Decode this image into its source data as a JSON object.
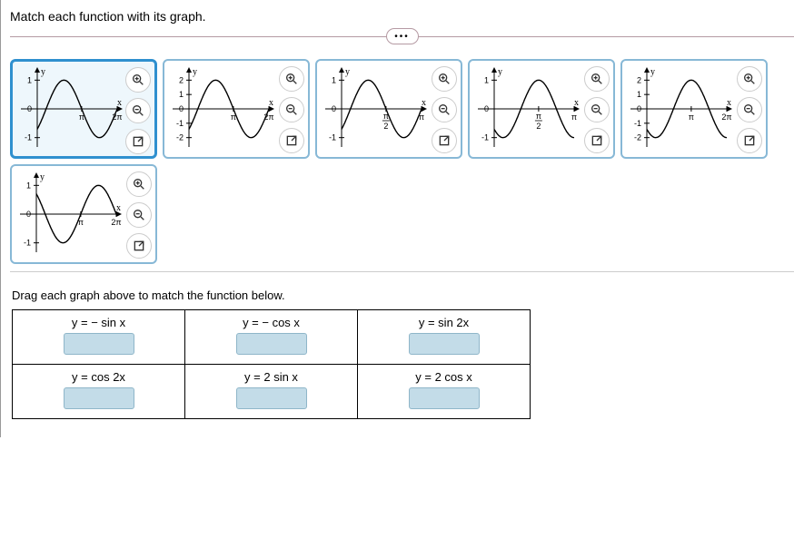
{
  "title": "Match each function with its graph.",
  "ellipsis": "•••",
  "instruction": "Drag each graph above to match the function below.",
  "icons": {
    "zoom_in": "zoom-in-icon",
    "zoom_out": "zoom-out-icon",
    "expand": "expand-icon"
  },
  "graphs": [
    {
      "id": 1,
      "selected": true,
      "y_ticks": [
        "1",
        "-1"
      ],
      "x_ticks": [
        "π",
        "2π"
      ],
      "amp": 1,
      "y_range": 1
    },
    {
      "id": 2,
      "selected": false,
      "y_ticks": [
        "2",
        "1",
        "-1",
        "-2"
      ],
      "x_ticks": [
        "π",
        "2π"
      ],
      "amp": 2,
      "y_range": 2
    },
    {
      "id": 3,
      "selected": false,
      "y_ticks": [
        "1",
        "-1"
      ],
      "x_ticks": [
        "π/2",
        "π"
      ],
      "amp": 1,
      "y_range": 1
    },
    {
      "id": 4,
      "selected": false,
      "y_ticks": [
        "1",
        "-1"
      ],
      "x_ticks": [
        "π/2",
        "π"
      ],
      "amp": 1,
      "y_range": 1
    },
    {
      "id": 5,
      "selected": false,
      "y_ticks": [
        "2",
        "1",
        "-1",
        "-2"
      ],
      "x_ticks": [
        "π",
        "2π"
      ],
      "amp": 2,
      "y_range": 2
    },
    {
      "id": 6,
      "selected": false,
      "y_ticks": [
        "1",
        "-1"
      ],
      "x_ticks": [
        "π",
        "2π"
      ],
      "amp": 1,
      "y_range": 1
    }
  ],
  "functions": {
    "row1": [
      "y = − sin x",
      "y = − cos x",
      "y = sin 2x"
    ],
    "row2": [
      "y = cos 2x",
      "y = 2 sin x",
      "y = 2 cos x"
    ]
  },
  "chart_data": [
    {
      "type": "line",
      "title": "",
      "xlabel": "x",
      "ylabel": "y",
      "xlim": [
        -0.785,
        6.283
      ],
      "ylim": [
        -1.2,
        1.2
      ],
      "x_ticks": [
        3.1416,
        6.2832
      ],
      "x_ticklabels": [
        "π",
        "2π"
      ],
      "y_ticks": [
        -1,
        0,
        1
      ],
      "function": "sin(x)",
      "amplitude": 1,
      "period": 6.2832,
      "phase": 0
    },
    {
      "type": "line",
      "title": "",
      "xlabel": "x",
      "ylabel": "y",
      "xlim": [
        -0.785,
        6.283
      ],
      "ylim": [
        -2.4,
        2.4
      ],
      "x_ticks": [
        3.1416,
        6.2832
      ],
      "x_ticklabels": [
        "π",
        "2π"
      ],
      "y_ticks": [
        -2,
        -1,
        0,
        1,
        2
      ],
      "function": "2*sin(x)",
      "amplitude": 2,
      "period": 6.2832,
      "phase": 0
    },
    {
      "type": "line",
      "title": "",
      "xlabel": "x",
      "ylabel": "y",
      "xlim": [
        -0.392,
        3.1416
      ],
      "ylim": [
        -1.2,
        1.2
      ],
      "x_ticks": [
        1.5708,
        3.1416
      ],
      "x_ticklabels": [
        "π/2",
        "π"
      ],
      "y_ticks": [
        -1,
        0,
        1
      ],
      "function": "sin(2x)",
      "amplitude": 1,
      "period": 3.1416,
      "phase": 0
    },
    {
      "type": "line",
      "title": "",
      "xlabel": "x",
      "ylabel": "y",
      "xlim": [
        -0.392,
        3.1416
      ],
      "ylim": [
        -1.2,
        1.2
      ],
      "x_ticks": [
        1.5708,
        3.1416
      ],
      "x_ticklabels": [
        "π/2",
        "π"
      ],
      "y_ticks": [
        -1,
        0,
        1
      ],
      "function": "-cos(2x)",
      "amplitude": 1,
      "period": 3.1416,
      "phase": 1.5708
    },
    {
      "type": "line",
      "title": "",
      "xlabel": "x",
      "ylabel": "y",
      "xlim": [
        -0.785,
        6.283
      ],
      "ylim": [
        -2.4,
        2.4
      ],
      "x_ticks": [
        3.1416,
        6.2832
      ],
      "x_ticklabels": [
        "π",
        "2π"
      ],
      "y_ticks": [
        -2,
        -1,
        0,
        1,
        2
      ],
      "function": "-2*cos(x)",
      "amplitude": 2,
      "period": 6.2832,
      "phase": 3.1416
    },
    {
      "type": "line",
      "title": "",
      "xlabel": "x",
      "ylabel": "y",
      "xlim": [
        -0.785,
        6.283
      ],
      "ylim": [
        -1.2,
        1.2
      ],
      "x_ticks": [
        3.1416,
        6.2832
      ],
      "x_ticklabels": [
        "π",
        "2π"
      ],
      "y_ticks": [
        -1,
        0,
        1
      ],
      "function": "-sin(x)",
      "amplitude": 1,
      "period": 6.2832,
      "phase": 3.1416
    }
  ]
}
